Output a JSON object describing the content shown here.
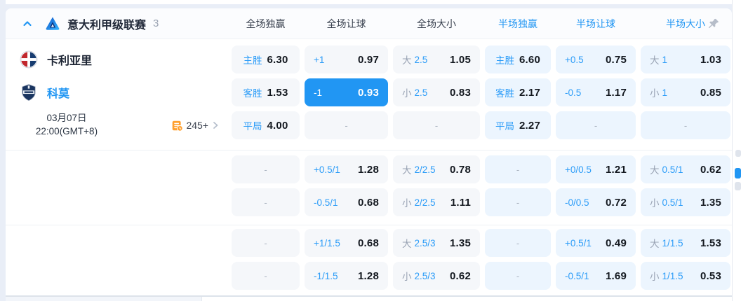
{
  "colors": {
    "accent_blue": "#2196f3",
    "selected_cell_bg": "#2196f3",
    "fulltime_cell_bg": "#f5f7fa",
    "halftime_cell_bg": "#ecf5fe",
    "label_blue": "#2b9cf8",
    "prefix_gray": "#98a2b3",
    "markets_icon_orange": "#ffa02f"
  },
  "league_header": {
    "title": "意大利甲级联赛",
    "count": "3",
    "collapse_icon": "chevron-up-icon",
    "pin_icon": "pushpin-icon",
    "columns": [
      {
        "label": "全场独赢",
        "half": false
      },
      {
        "label": "全场让球",
        "half": false
      },
      {
        "label": "全场大小",
        "half": false
      },
      {
        "label": "半场独赢",
        "half": true
      },
      {
        "label": "半场让球",
        "half": true
      },
      {
        "label": "半场大小",
        "half": true
      }
    ]
  },
  "match": {
    "home_team": "卡利亚里",
    "away_team": "科莫",
    "date_line1": "03月07日",
    "date_line2": "22:00(GMT+8)",
    "markets_count": "245+"
  },
  "odds": {
    "empty_placeholder": "-",
    "sections": [
      {
        "rows": [
          [
            {
              "t": "win",
              "l": "主胜",
              "v": "6.30"
            },
            {
              "t": "hcp",
              "l": "+1",
              "v": "0.97"
            },
            {
              "t": "ou",
              "p": "大",
              "l": "2.5",
              "v": "1.05"
            },
            {
              "t": "win",
              "l": "主胜",
              "v": "6.60",
              "h": 1
            },
            {
              "t": "hcp",
              "l": "+0.5",
              "v": "0.75",
              "h": 1
            },
            {
              "t": "ou",
              "p": "大",
              "l": "1",
              "v": "1.03",
              "h": 1
            }
          ],
          [
            {
              "t": "win",
              "l": "客胜",
              "v": "1.53"
            },
            {
              "t": "hcp",
              "l": "-1",
              "v": "0.93",
              "sel": 1
            },
            {
              "t": "ou",
              "p": "小",
              "l": "2.5",
              "v": "0.83"
            },
            {
              "t": "win",
              "l": "客胜",
              "v": "2.17",
              "h": 1
            },
            {
              "t": "hcp",
              "l": "-0.5",
              "v": "1.17",
              "h": 1
            },
            {
              "t": "ou",
              "p": "小",
              "l": "1",
              "v": "0.85",
              "h": 1
            }
          ],
          [
            {
              "t": "win",
              "l": "平局",
              "v": "4.00"
            },
            {
              "t": "empty"
            },
            {
              "t": "empty"
            },
            {
              "t": "win",
              "l": "平局",
              "v": "2.27",
              "h": 1
            },
            {
              "t": "empty",
              "h": 1
            },
            {
              "t": "empty",
              "h": 1
            }
          ]
        ]
      },
      {
        "rows": [
          [
            {
              "t": "empty"
            },
            {
              "t": "hcp",
              "l": "+0.5/1",
              "v": "1.28"
            },
            {
              "t": "ou",
              "p": "大",
              "l": "2/2.5",
              "v": "0.78"
            },
            {
              "t": "empty",
              "h": 1
            },
            {
              "t": "hcp",
              "l": "+0/0.5",
              "v": "1.21",
              "h": 1
            },
            {
              "t": "ou",
              "p": "大",
              "l": "0.5/1",
              "v": "0.62",
              "h": 1
            }
          ],
          [
            {
              "t": "empty"
            },
            {
              "t": "hcp",
              "l": "-0.5/1",
              "v": "0.68"
            },
            {
              "t": "ou",
              "p": "小",
              "l": "2/2.5",
              "v": "1.11"
            },
            {
              "t": "empty",
              "h": 1
            },
            {
              "t": "hcp",
              "l": "-0/0.5",
              "v": "0.72",
              "h": 1
            },
            {
              "t": "ou",
              "p": "小",
              "l": "0.5/1",
              "v": "1.35",
              "h": 1
            }
          ]
        ]
      },
      {
        "rows": [
          [
            {
              "t": "empty"
            },
            {
              "t": "hcp",
              "l": "+1/1.5",
              "v": "0.68"
            },
            {
              "t": "ou",
              "p": "大",
              "l": "2.5/3",
              "v": "1.35"
            },
            {
              "t": "empty",
              "h": 1
            },
            {
              "t": "hcp",
              "l": "+0.5/1",
              "v": "0.49",
              "h": 1
            },
            {
              "t": "ou",
              "p": "大",
              "l": "1/1.5",
              "v": "1.53",
              "h": 1
            }
          ],
          [
            {
              "t": "empty"
            },
            {
              "t": "hcp",
              "l": "-1/1.5",
              "v": "1.28"
            },
            {
              "t": "ou",
              "p": "小",
              "l": "2.5/3",
              "v": "0.62"
            },
            {
              "t": "empty",
              "h": 1
            },
            {
              "t": "hcp",
              "l": "-0.5/1",
              "v": "1.69",
              "h": 1
            },
            {
              "t": "ou",
              "p": "小",
              "l": "1/1.5",
              "v": "0.53",
              "h": 1
            }
          ]
        ]
      }
    ]
  }
}
